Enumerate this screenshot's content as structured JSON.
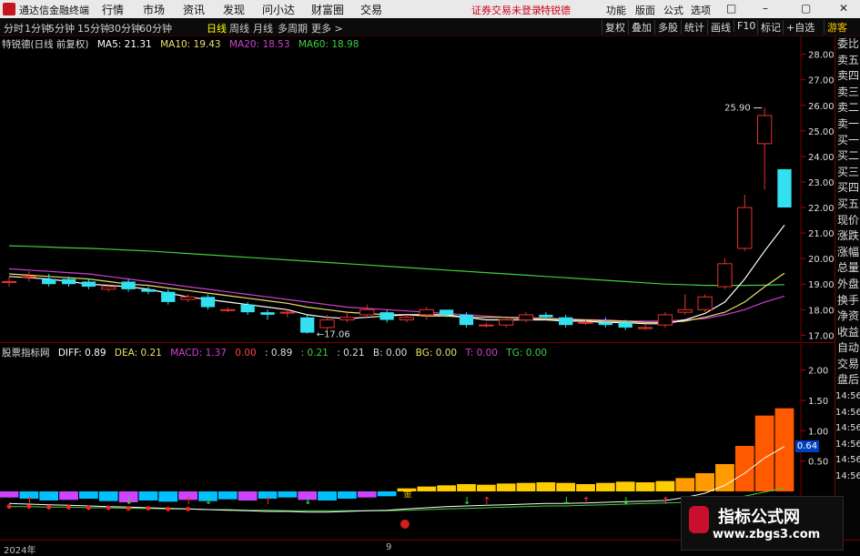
{
  "menubar": {
    "app_name": "通达信金融终端",
    "items": [
      "行情",
      "市场",
      "资讯",
      "发现",
      "问小达",
      "财富圈",
      "交易"
    ],
    "notice": "证券交易未登录",
    "stock": "特锐德",
    "right_items": [
      "功能",
      "版面",
      "公式",
      "选项"
    ],
    "window_buttons": [
      "□",
      "–",
      "▢",
      "✕"
    ]
  },
  "toolbar": {
    "periods": [
      "分时",
      "1分钟",
      "5分钟",
      "15分钟",
      "30分钟",
      "60分钟",
      "日线",
      "周线",
      "月线",
      "多周期",
      "更多 >"
    ],
    "active_period": "日线",
    "right_buttons": [
      "复权",
      "叠加",
      "多股",
      "统计",
      "画线",
      "F10",
      "标记",
      "+自选",
      "游客"
    ]
  },
  "info": {
    "title": "特锐德(日线 前复权)",
    "ma5": "MA5: 21.31",
    "ma10": "MA10: 19.43",
    "ma20": "MA20: 18.53",
    "ma60": "MA60: 18.98"
  },
  "annotations": {
    "high": "25.90",
    "low": "17.06",
    "cai": "财"
  },
  "price_axis": [
    "28.00",
    "27.00",
    "26.00",
    "25.00",
    "24.00",
    "23.00",
    "22.00",
    "21.00",
    "20.00",
    "19.00",
    "18.00",
    "17.00"
  ],
  "indicator": {
    "name": "股票指标网",
    "diff": "DIFF: 0.89",
    "dea": "DEA: 0.21",
    "macd": "MACD: 1.37",
    "v1": "0.00",
    "v2": ": 0.89",
    "v3": ": 0.21",
    "v4": ": 0.21",
    "b": "B: 0.00",
    "bg": "BG: 0.00",
    "t": "T: 0.00",
    "tg": "TG: 0.00",
    "axis": [
      "2.00",
      "1.50",
      "1.00",
      "0.50"
    ],
    "last_value": "0.64",
    "gold_label": "金"
  },
  "sidebar": [
    "委比",
    "卖五",
    "卖四",
    "卖三",
    "卖二",
    "卖一",
    "买一",
    "买二",
    "买三",
    "买四",
    "买五",
    "现价",
    "涨跌",
    "涨幅",
    "总量",
    "外盘",
    "换手",
    "净资",
    "收益",
    "自动",
    "交易",
    "盘后",
    "14:56",
    "14:56",
    "14:56",
    "14:56",
    "14:56",
    "14:56"
  ],
  "dates": {
    "year": "2024年",
    "month": "9"
  },
  "watermark": {
    "title": "指标公式网",
    "url": "www.zbgs3.com"
  },
  "colors": {
    "up": "#e8312f",
    "down": "#32e0f0",
    "ma5": "#ffffff",
    "ma10": "#e8e06a",
    "ma20": "#d040d0",
    "ma60": "#40d040",
    "macd_up": "#ff8800",
    "macd_down": "#00c0ff"
  },
  "chart_data": {
    "type": "candlestick",
    "ylim": [
      16.8,
      28.2
    ],
    "candles": [
      {
        "o": 19.1,
        "c": 19.1,
        "h": 19.3,
        "l": 18.9
      },
      {
        "o": 19.3,
        "c": 19.3,
        "h": 19.5,
        "l": 19.1
      },
      {
        "o": 19.2,
        "c": 19.0,
        "h": 19.4,
        "l": 18.9
      },
      {
        "o": 19.2,
        "c": 19.0,
        "h": 19.3,
        "l": 18.9
      },
      {
        "o": 19.1,
        "c": 18.9,
        "h": 19.2,
        "l": 18.8
      },
      {
        "o": 18.8,
        "c": 18.9,
        "h": 19.0,
        "l": 18.7
      },
      {
        "o": 19.1,
        "c": 18.8,
        "h": 19.2,
        "l": 18.7
      },
      {
        "o": 18.8,
        "c": 18.7,
        "h": 18.9,
        "l": 18.6
      },
      {
        "o": 18.7,
        "c": 18.3,
        "h": 18.8,
        "l": 18.2
      },
      {
        "o": 18.4,
        "c": 18.5,
        "h": 18.6,
        "l": 18.3
      },
      {
        "o": 18.5,
        "c": 18.1,
        "h": 18.6,
        "l": 18.0
      },
      {
        "o": 18.0,
        "c": 18.0,
        "h": 18.1,
        "l": 17.9
      },
      {
        "o": 18.2,
        "c": 17.9,
        "h": 18.3,
        "l": 17.8
      },
      {
        "o": 17.9,
        "c": 17.8,
        "h": 18.0,
        "l": 17.6
      },
      {
        "o": 17.9,
        "c": 17.9,
        "h": 18.0,
        "l": 17.7
      },
      {
        "o": 17.7,
        "c": 17.1,
        "h": 17.8,
        "l": 17.06
      },
      {
        "o": 17.3,
        "c": 17.6,
        "h": 17.8,
        "l": 17.1
      },
      {
        "o": 17.6,
        "c": 17.7,
        "h": 17.9,
        "l": 17.5
      },
      {
        "o": 17.8,
        "c": 18.0,
        "h": 18.2,
        "l": 17.7
      },
      {
        "o": 17.9,
        "c": 17.6,
        "h": 18.0,
        "l": 17.5
      },
      {
        "o": 17.6,
        "c": 17.7,
        "h": 17.8,
        "l": 17.5
      },
      {
        "o": 17.8,
        "c": 18.0,
        "h": 18.1,
        "l": 17.6
      },
      {
        "o": 18.0,
        "c": 17.8,
        "h": 18.0,
        "l": 17.7
      },
      {
        "o": 17.8,
        "c": 17.4,
        "h": 17.9,
        "l": 17.3
      },
      {
        "o": 17.4,
        "c": 17.4,
        "h": 17.5,
        "l": 17.3
      },
      {
        "o": 17.4,
        "c": 17.6,
        "h": 17.7,
        "l": 17.3
      },
      {
        "o": 17.6,
        "c": 17.8,
        "h": 17.9,
        "l": 17.5
      },
      {
        "o": 17.8,
        "c": 17.7,
        "h": 17.9,
        "l": 17.6
      },
      {
        "o": 17.7,
        "c": 17.4,
        "h": 17.8,
        "l": 17.3
      },
      {
        "o": 17.5,
        "c": 17.5,
        "h": 17.6,
        "l": 17.4
      },
      {
        "o": 17.5,
        "c": 17.4,
        "h": 17.7,
        "l": 17.3
      },
      {
        "o": 17.5,
        "c": 17.3,
        "h": 17.6,
        "l": 17.2
      },
      {
        "o": 17.3,
        "c": 17.3,
        "h": 17.4,
        "l": 17.2
      },
      {
        "o": 17.4,
        "c": 17.8,
        "h": 17.9,
        "l": 17.3
      },
      {
        "o": 17.9,
        "c": 18.0,
        "h": 18.6,
        "l": 17.8
      },
      {
        "o": 18.0,
        "c": 18.5,
        "h": 18.6,
        "l": 17.9
      },
      {
        "o": 18.9,
        "c": 19.8,
        "h": 20.0,
        "l": 18.8
      },
      {
        "o": 20.4,
        "c": 22.0,
        "h": 22.5,
        "l": 20.3
      },
      {
        "o": 24.5,
        "c": 25.6,
        "h": 25.9,
        "l": 22.7
      },
      {
        "o": 23.5,
        "c": 22.0,
        "h": 23.5,
        "l": 22.0
      }
    ],
    "ma5": [
      19.3,
      19.25,
      19.2,
      19.1,
      19.0,
      18.95,
      18.9,
      18.8,
      18.65,
      18.5,
      18.4,
      18.3,
      18.2,
      18.1,
      18.0,
      17.8,
      17.7,
      17.65,
      17.7,
      17.75,
      17.8,
      17.8,
      17.8,
      17.7,
      17.6,
      17.6,
      17.6,
      17.6,
      17.55,
      17.55,
      17.5,
      17.5,
      17.45,
      17.45,
      17.6,
      17.85,
      18.3,
      19.2,
      20.3,
      21.31
    ],
    "ma10": [
      19.4,
      19.35,
      19.3,
      19.25,
      19.2,
      19.1,
      19.0,
      18.95,
      18.85,
      18.75,
      18.65,
      18.55,
      18.45,
      18.35,
      18.25,
      18.1,
      18.0,
      17.9,
      17.85,
      17.8,
      17.8,
      17.75,
      17.75,
      17.7,
      17.7,
      17.7,
      17.65,
      17.65,
      17.6,
      17.6,
      17.55,
      17.55,
      17.5,
      17.5,
      17.55,
      17.7,
      17.9,
      18.3,
      18.9,
      19.43
    ],
    "ma20": [
      19.6,
      19.55,
      19.5,
      19.45,
      19.4,
      19.3,
      19.2,
      19.1,
      19.0,
      18.9,
      18.8,
      18.7,
      18.6,
      18.5,
      18.4,
      18.3,
      18.2,
      18.1,
      18.05,
      18.0,
      17.95,
      17.9,
      17.85,
      17.8,
      17.75,
      17.7,
      17.7,
      17.65,
      17.65,
      17.6,
      17.6,
      17.55,
      17.55,
      17.55,
      17.6,
      17.65,
      17.8,
      18.0,
      18.3,
      18.53
    ],
    "ma60": [
      20.5,
      20.48,
      20.45,
      20.42,
      20.4,
      20.37,
      20.33,
      20.3,
      20.25,
      20.2,
      20.15,
      20.1,
      20.05,
      20.0,
      19.95,
      19.9,
      19.85,
      19.8,
      19.75,
      19.7,
      19.65,
      19.6,
      19.55,
      19.5,
      19.45,
      19.4,
      19.35,
      19.3,
      19.25,
      19.2,
      19.15,
      19.1,
      19.05,
      19.0,
      18.98,
      18.95,
      18.95,
      18.95,
      18.96,
      18.98
    ],
    "macd": [
      -0.1,
      -0.12,
      -0.15,
      -0.14,
      -0.12,
      -0.16,
      -0.18,
      -0.15,
      -0.17,
      -0.14,
      -0.16,
      -0.13,
      -0.15,
      -0.12,
      -0.1,
      -0.14,
      -0.15,
      -0.12,
      -0.1,
      -0.08,
      0.05,
      0.08,
      0.1,
      0.12,
      0.11,
      0.13,
      0.14,
      0.15,
      0.14,
      0.12,
      0.14,
      0.16,
      0.15,
      0.17,
      0.22,
      0.3,
      0.45,
      0.75,
      1.25,
      1.37
    ],
    "diff": [
      -0.05,
      -0.06,
      -0.07,
      -0.08,
      -0.09,
      -0.1,
      -0.11,
      -0.12,
      -0.13,
      -0.14,
      -0.15,
      -0.16,
      -0.17,
      -0.18,
      -0.18,
      -0.19,
      -0.19,
      -0.18,
      -0.17,
      -0.16,
      -0.14,
      -0.12,
      -0.1,
      -0.09,
      -0.08,
      -0.07,
      -0.06,
      -0.05,
      -0.05,
      -0.04,
      -0.03,
      -0.02,
      -0.01,
      0.0,
      0.05,
      0.12,
      0.25,
      0.45,
      0.7,
      0.89
    ],
    "dea": [
      -0.1,
      -0.1,
      -0.11,
      -0.11,
      -0.12,
      -0.12,
      -0.13,
      -0.13,
      -0.14,
      -0.14,
      -0.15,
      -0.15,
      -0.16,
      -0.16,
      -0.17,
      -0.17,
      -0.17,
      -0.17,
      -0.17,
      -0.17,
      -0.16,
      -0.15,
      -0.14,
      -0.13,
      -0.12,
      -0.11,
      -0.1,
      -0.09,
      -0.09,
      -0.08,
      -0.07,
      -0.06,
      -0.05,
      -0.04,
      -0.03,
      -0.01,
      0.02,
      0.07,
      0.14,
      0.21
    ]
  }
}
